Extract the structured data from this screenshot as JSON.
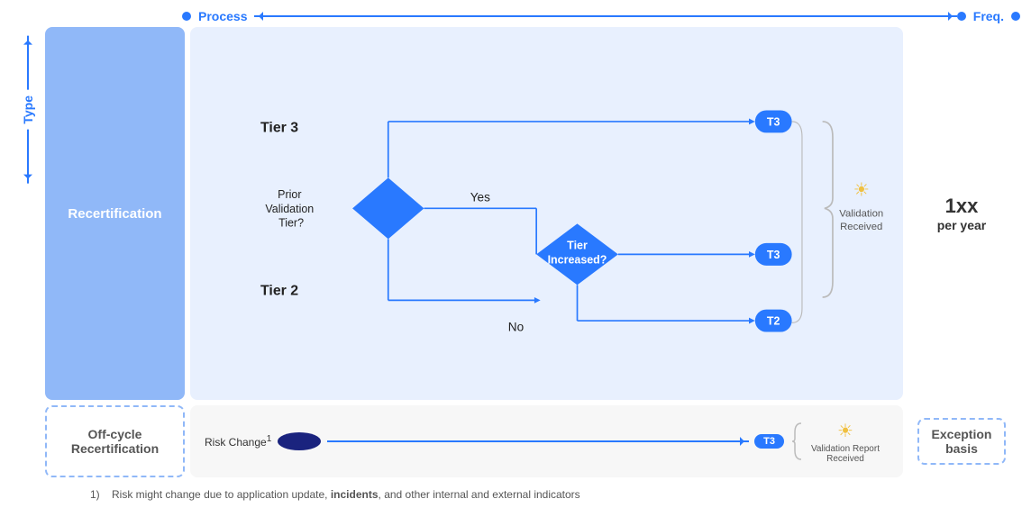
{
  "header": {
    "process_label": "Process",
    "freq_label": "Freq."
  },
  "type_label": "Type",
  "recertification_label": "Recertification",
  "offcycle_label": "Off-cycle\nRecertification",
  "freq": {
    "value": "1x",
    "unit": "per year"
  },
  "exception_label": "Exception\nbasis",
  "diagram": {
    "tier3_label": "Tier 3",
    "tier2_label": "Tier 2",
    "prior_validation_label": "Prior\nValidation\nTier?",
    "tier_increased_label": "Tier\nIncreased?",
    "yes_label": "Yes",
    "no_label": "No",
    "t3_badge": "T3",
    "t2_badge": "T2",
    "t3_badge2": "T3",
    "t3_badge3": "T3",
    "validation_received_label": "Validation\nReceived",
    "validation_report_received_label": "Validation Report\nReceived"
  },
  "offcycle": {
    "risk_change_label": "Risk Change",
    "risk_change_superscript": "1"
  },
  "footnote": {
    "number": "1)",
    "text": "Risk might change due to application update, ",
    "bold_text": "incidents",
    "text2": ", and other internal and external indicators"
  }
}
